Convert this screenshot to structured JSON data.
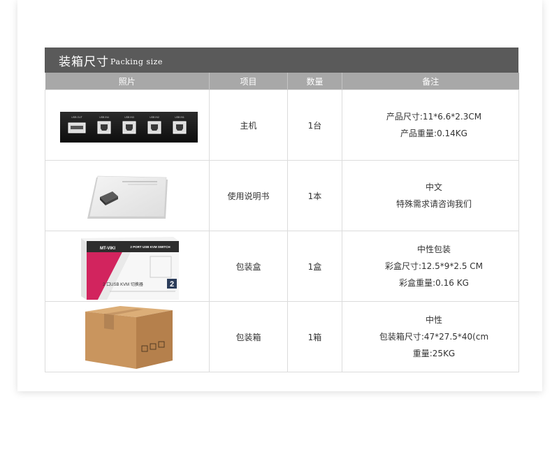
{
  "section": {
    "title_cn": "装箱尺寸",
    "title_en": "Packing size"
  },
  "table": {
    "headers": [
      "照片",
      "项目",
      "数量",
      "备注"
    ],
    "rows": [
      {
        "photo_icon": "kvm-switch-rear-panel-photo",
        "item": "主机",
        "qty": "1台",
        "notes": [
          "产品尺寸:11*6.6*2.3CM",
          "产品重量:0.14KG"
        ]
      },
      {
        "photo_icon": "user-manual-photo",
        "item": "使用说明书",
        "qty": "1本",
        "notes": [
          "中文",
          "特殊需求请咨询我们"
        ]
      },
      {
        "photo_icon": "color-box-photo",
        "item": "包装盒",
        "qty": "1盒",
        "notes": [
          "中性包装",
          "彩盒尺寸:12.5*9*2.5 CM",
          "彩盒重量:0.16 KG"
        ]
      },
      {
        "photo_icon": "shipping-carton-photo",
        "item": "包装箱",
        "qty": "1箱",
        "notes": [
          "中性",
          "包装箱尺寸:47*27.5*40(cm",
          "重量:25KG"
        ]
      }
    ]
  },
  "photo_labels": {
    "panel_ports": [
      "USB OUT",
      "USB IN4",
      "USB IN3",
      "USB IN2",
      "USB IN1"
    ],
    "box_brand": "MT-VIKI",
    "box_top_text": "2 PORT USB KVM SWITCH",
    "box_front_text": "2 口USB KVM 切换器",
    "box_badge": "2"
  },
  "colors": {
    "title_bar": "#5a5a5a",
    "header_bar": "#a8a8a8",
    "border": "#dcdcdc",
    "box_accent": "#d2245e",
    "carton": "#c9955e"
  }
}
